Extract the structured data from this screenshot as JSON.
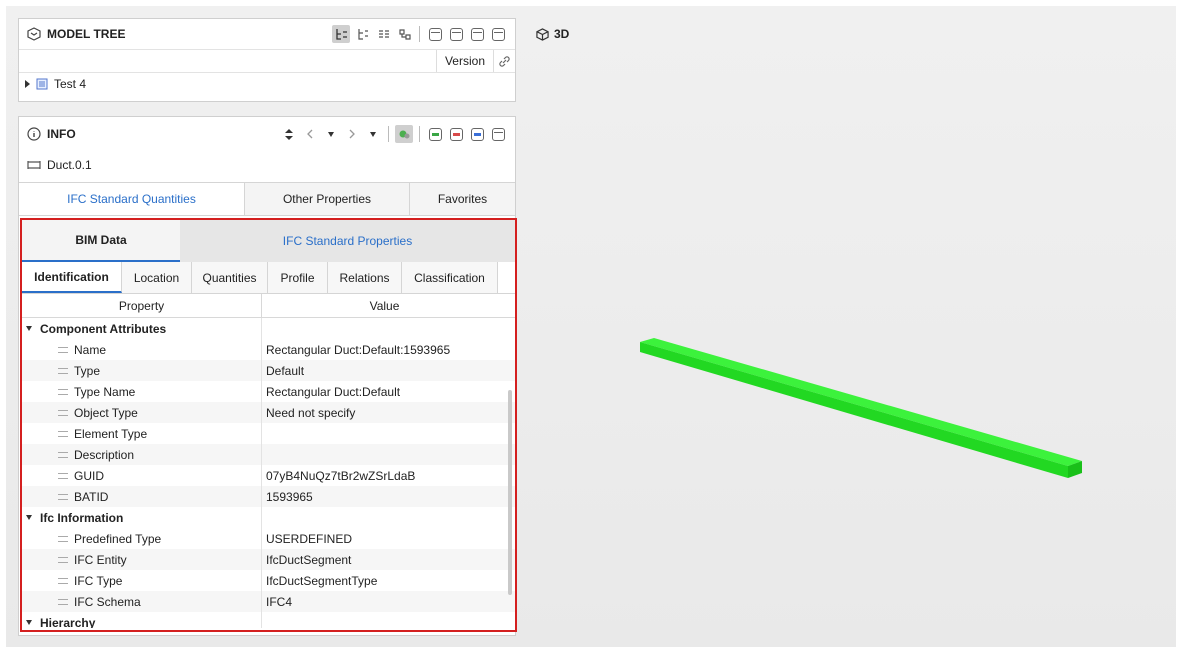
{
  "model_tree": {
    "title": "MODEL TREE",
    "version_label": "Version",
    "items": [
      {
        "label": "Test 4"
      }
    ]
  },
  "info": {
    "title": "INFO",
    "element_name": "Duct.0.1",
    "tabs": [
      "IFC Standard Quantities",
      "Other Properties",
      "Favorites"
    ]
  },
  "bim": {
    "tabs": [
      "BIM Data",
      "IFC Standard Properties"
    ],
    "subtabs": [
      "Identification",
      "Location",
      "Quantities",
      "Profile",
      "Relations",
      "Classification"
    ],
    "columns": {
      "property": "Property",
      "value": "Value"
    },
    "groups": [
      {
        "name": "Component Attributes",
        "rows": [
          {
            "property": "Name",
            "value": "Rectangular Duct:Default:1593965"
          },
          {
            "property": "Type",
            "value": "Default"
          },
          {
            "property": "Type Name",
            "value": "Rectangular Duct:Default"
          },
          {
            "property": "Object Type",
            "value": "Need not specify"
          },
          {
            "property": "Element Type",
            "value": ""
          },
          {
            "property": "Description",
            "value": ""
          },
          {
            "property": "GUID",
            "value": "07yB4NuQz7tBr2wZSrLdaB"
          },
          {
            "property": "BATID",
            "value": "1593965"
          }
        ]
      },
      {
        "name": "Ifc Information",
        "rows": [
          {
            "property": "Predefined Type",
            "value": "USERDEFINED"
          },
          {
            "property": "IFC Entity",
            "value": "IfcDuctSegment"
          },
          {
            "property": "IFC Type",
            "value": "IfcDuctSegmentType"
          },
          {
            "property": "IFC Schema",
            "value": "IFC4"
          }
        ]
      },
      {
        "name": "Hierarchy",
        "rows": []
      }
    ]
  },
  "viewport": {
    "label": "3D",
    "object_color": "#2ee82e"
  }
}
